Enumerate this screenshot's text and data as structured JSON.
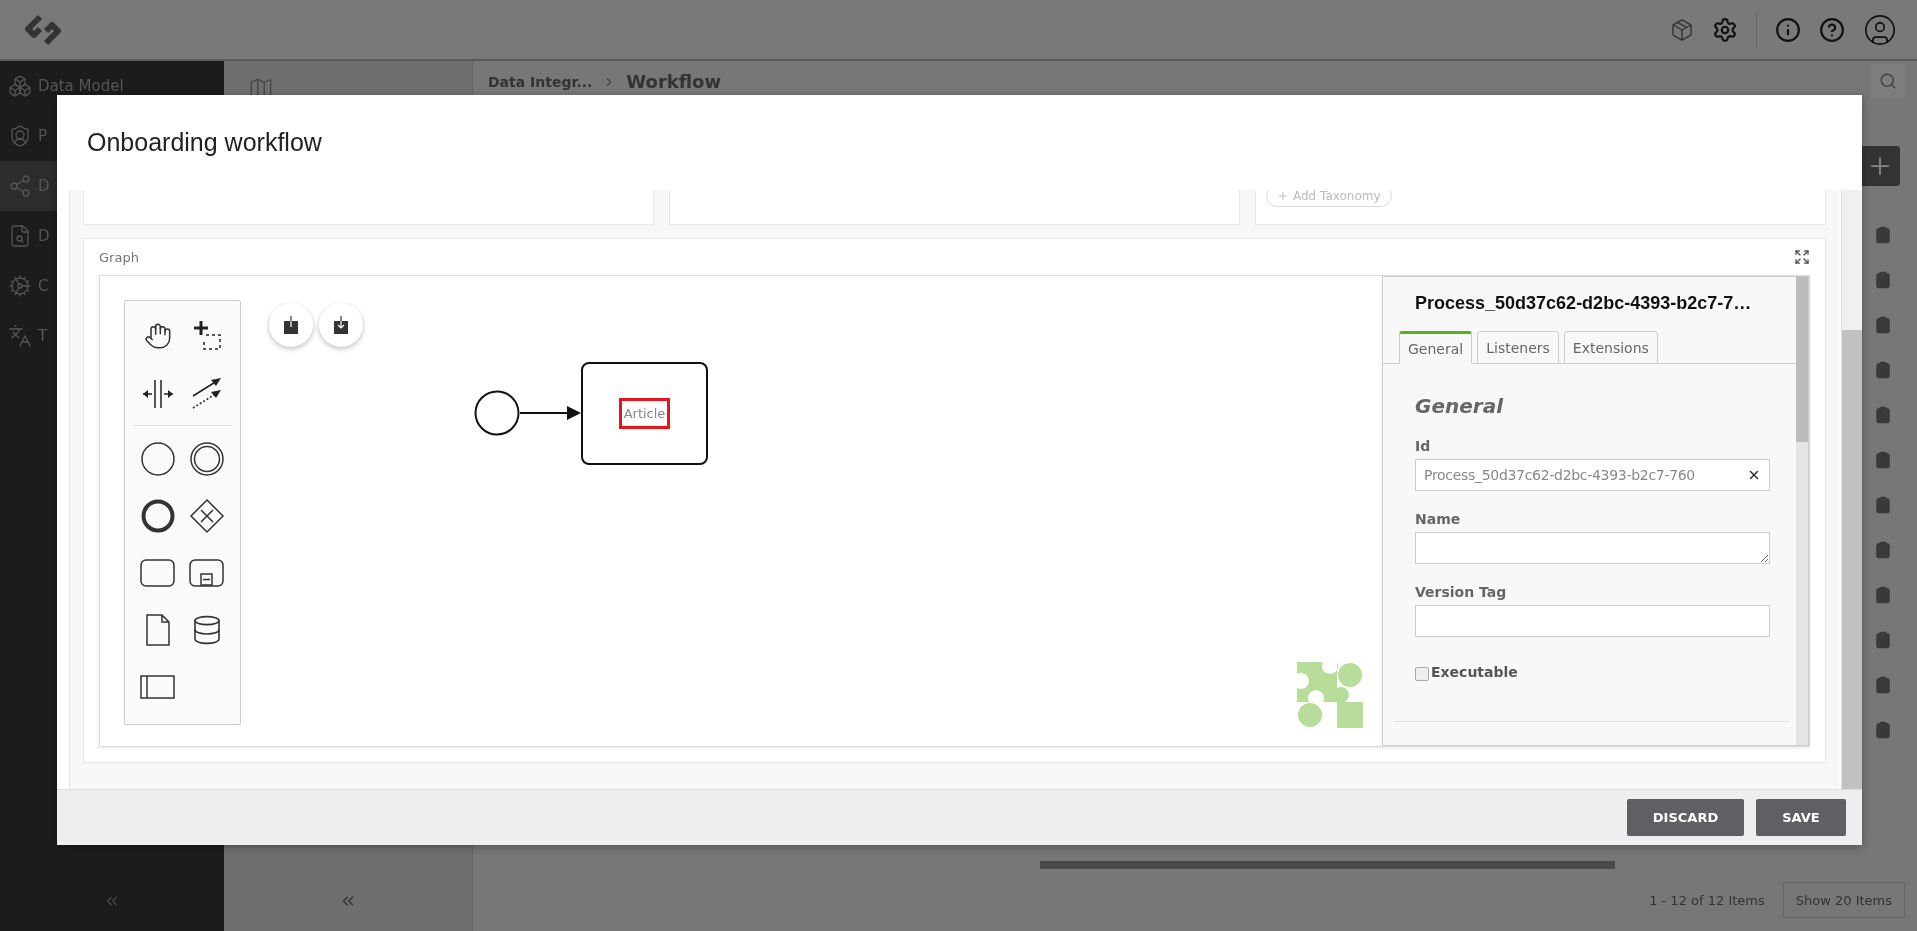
{
  "sidebar": {
    "items": [
      {
        "label": "Data Model",
        "selected": false
      },
      {
        "label": "P",
        "selected": false
      },
      {
        "label": "D",
        "selected": true
      },
      {
        "label": "D",
        "selected": false
      },
      {
        "label": "C",
        "selected": false
      },
      {
        "label": "T",
        "selected": false
      }
    ]
  },
  "breadcrumb": [
    "Data Integr...",
    "Workflow"
  ],
  "pagination": {
    "summary": "1 - 12 of 12 Items",
    "page_size_button": "Show 20 Items"
  },
  "modal": {
    "title": "Onboarding workflow",
    "taxonomy_chip": "Add Taxonomy",
    "graph": {
      "label": "Graph",
      "task": {
        "label": "Article",
        "highlighted": true
      },
      "properties": {
        "title": "Process_50d37c62-d2bc-4393-b2c7-7…",
        "tabs": [
          {
            "label": "General",
            "selected": true
          },
          {
            "label": "Listeners",
            "selected": false
          },
          {
            "label": "Extensions",
            "selected": false
          }
        ],
        "section": "General",
        "fields": [
          {
            "label": "Id",
            "kind": "text",
            "value": "Process_50d37c62-d2bc-4393-b2c7-760",
            "clearable": true
          },
          {
            "label": "Name",
            "kind": "textarea"
          },
          {
            "label": "Version Tag",
            "kind": "text"
          }
        ],
        "executable": {
          "label": "Executable",
          "checked": false
        }
      }
    },
    "buttons": [
      "DISCARD",
      "SAVE"
    ]
  }
}
